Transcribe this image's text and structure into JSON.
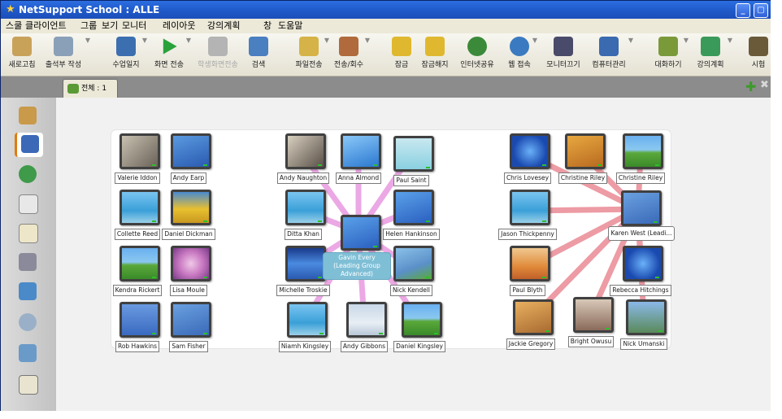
{
  "window": {
    "title": "NetSupport School : ALLE",
    "minimize_glyph": "_",
    "restore_glyph": "▢"
  },
  "menu": [
    "스쿨",
    "클라이언트",
    "그룹",
    "보기",
    "모니터",
    "레이아웃",
    "강의계획",
    "창",
    "도움말"
  ],
  "toolbar": [
    {
      "label": "새로고침",
      "icon": "refresh-icon",
      "color": "#c9a25a"
    },
    {
      "label": "출석부 작성",
      "icon": "register-icon",
      "color": "#8aa0b8"
    },
    {
      "label": "수업일지",
      "icon": "journal-icon",
      "color": "#3c6fb0"
    },
    {
      "label": "화면 전송",
      "icon": "show-screen-icon",
      "color": "#2aa23a"
    },
    {
      "label": "학생화면전송",
      "icon": "exhibit-icon",
      "color": "#9a9a9a",
      "disabled": true
    },
    {
      "label": "검색",
      "icon": "search-icon",
      "color": "#4a7fc0"
    },
    {
      "label": "파일전송",
      "icon": "file-transfer-icon",
      "color": "#d6b348"
    },
    {
      "label": "전송/회수",
      "icon": "distribute-icon",
      "color": "#b06a3c"
    },
    {
      "label": "잠금",
      "icon": "lock-icon",
      "color": "#e0b830"
    },
    {
      "label": "잠금해지",
      "icon": "unlock-icon",
      "color": "#e0b830"
    },
    {
      "label": "인터넷공유",
      "icon": "internet-icon",
      "color": "#3a8a3a"
    },
    {
      "label": "웹 접속",
      "icon": "web-icon",
      "color": "#3a7ac0"
    },
    {
      "label": "모니터끄기",
      "icon": "monitor-off-icon",
      "color": "#4a4a6a"
    },
    {
      "label": "컴퓨터관리",
      "icon": "computer-manage-icon",
      "color": "#3a6ab0"
    },
    {
      "label": "대화하기",
      "icon": "chat-icon",
      "color": "#7a9a3a"
    },
    {
      "label": "강의계획",
      "icon": "lesson-plan-icon",
      "color": "#3a9a5a"
    },
    {
      "label": "시험",
      "icon": "test-icon",
      "color": "#6a5a3a"
    }
  ],
  "tab": {
    "label": "전체 : 1"
  },
  "sidebar_icons": [
    "clients-icon",
    "monitor-icon",
    "globe-icon",
    "document-icon",
    "clipboard-icon",
    "printer-icon",
    "users-icon",
    "cd-icon",
    "eraser-icon",
    "notepad-icon"
  ],
  "students": {
    "group1": [
      "Valerie Iddon",
      "Andy Earp",
      "Collette Reed",
      "Daniel Dickman",
      "Kendra Rickert",
      "Lisa Moule",
      "Rob Hawkins",
      "Sam Fisher"
    ],
    "group2": {
      "leader": "Gavin Every (Leading Group Advanced)",
      "members": [
        "Andy Naughton",
        "Anna Almond",
        "Paul Saint",
        "Ditta Khan",
        "Helen Hankinson",
        "Michelle Troskie",
        "Nick Kendell",
        "Niamh Kingsley",
        "Andy Gibbons",
        "Daniel Kingsley"
      ]
    },
    "group3": {
      "leader": "Karen West (Leadi...",
      "members": [
        "Chris Lovesey",
        "Christine Riley",
        "Christine Riley",
        "Jason Thickpenny",
        "Paul Blyth",
        "Rebecca Hitchings",
        "Jackie Gregory",
        "Bright Owusu",
        "Nick Umanski"
      ]
    }
  }
}
